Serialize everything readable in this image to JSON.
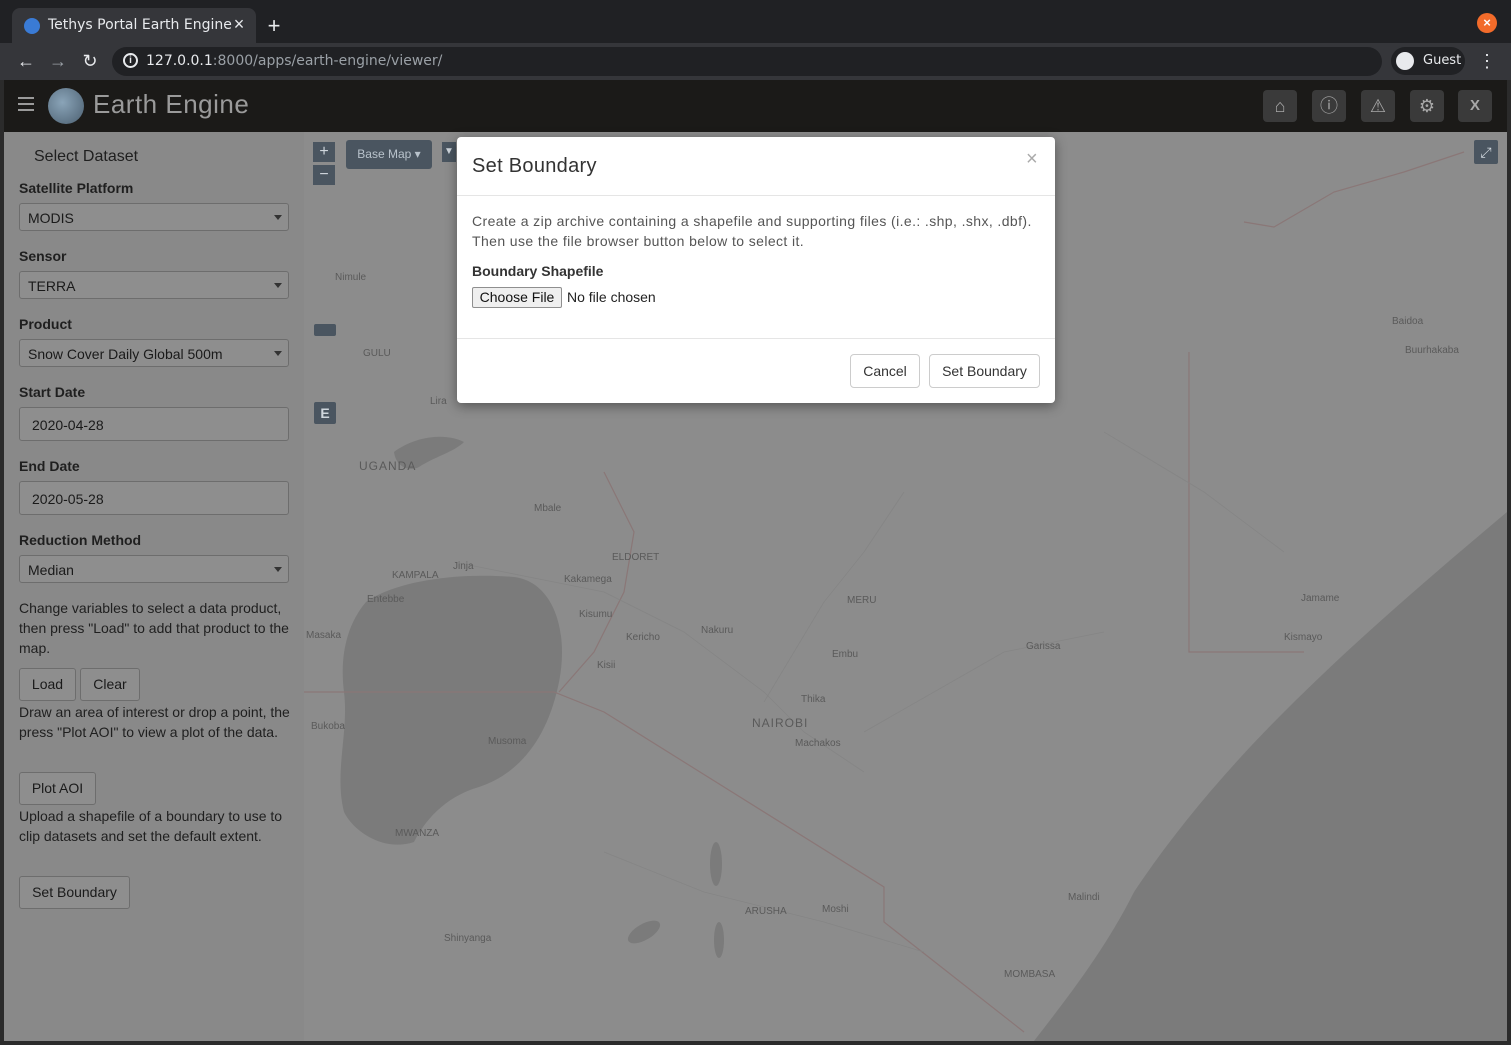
{
  "browser": {
    "tab_title": "Tethys Portal Earth Engine",
    "url_host": "127.0.0.1",
    "url_rest": ":8000/apps/earth-engine/viewer/",
    "profile_label": "Guest",
    "icons": [
      "back-arrow-icon",
      "forward-arrow-icon",
      "reload-icon",
      "info-icon",
      "close-icon",
      "plus-icon",
      "kebab-menu-icon"
    ],
    "window_close_color": "#f26b2a"
  },
  "app": {
    "title": "Earth Engine",
    "header_icons": [
      "home-icon",
      "info-icon",
      "warning-icon",
      "gear-icon"
    ],
    "exit_label": "X"
  },
  "sidebar": {
    "title": "Select Dataset",
    "platform_label": "Satellite Platform",
    "platform_value": "MODIS",
    "sensor_label": "Sensor",
    "sensor_value": "TERRA",
    "product_label": "Product",
    "product_value": "Snow Cover Daily Global 500m",
    "start_label": "Start Date",
    "start_value": "2020-04-28",
    "end_label": "End Date",
    "end_value": "2020-05-28",
    "reduction_label": "Reduction Method",
    "reduction_value": "Median",
    "load_help": "Change variables to select a data product, then press \"Load\" to add that product to the map.",
    "load_label": "Load",
    "clear_label": "Clear",
    "plot_help": "Draw an area of interest or drop a point, the press \"Plot AOI\" to view a plot of the data.",
    "plot_label": "Plot AOI",
    "boundary_help": "Upload a shapefile of a boundary to use to clip datasets and set the default extent.",
    "boundary_label": "Set Boundary"
  },
  "map": {
    "basemap_label": "Base Map",
    "zoom_in": "+",
    "zoom_out": "−",
    "draw_label": "E",
    "fullscreen_icon": "expand-icon",
    "places": {
      "nimule": "Nimule",
      "gulu": "GULU",
      "lira": "Lira",
      "uganda": "UGANDA",
      "mbale": "Mbale",
      "eldoret": "ELDORET",
      "kampala": "KAMPALA",
      "jinja": "Jinja",
      "kakamega": "Kakamega",
      "entebbe": "Entebbe",
      "kisumu": "Kisumu",
      "masaka": "Masaka",
      "kericho": "Kericho",
      "nakuru": "Nakuru",
      "kisii": "Kisii",
      "meru": "MERU",
      "embu": "Embu",
      "thika": "Thika",
      "nairobi": "NAIROBI",
      "machakos": "Machakos",
      "bukoba": "Bukoba",
      "musoma": "Musoma",
      "mwanza": "MWANZA",
      "arusha": "ARUSHA",
      "moshi": "Moshi",
      "shinyanga": "Shinyanga",
      "mombasa": "MOMBASA",
      "malindi": "Malindi",
      "garissa": "Garissa",
      "jamame": "Jamame",
      "kismayo": "Kismayo",
      "baidoa": "Baidoa",
      "buurhakaba": "Buurhakaba"
    }
  },
  "modal": {
    "title": "Set Boundary",
    "close": "×",
    "description": "Create a zip archive containing a shapefile and supporting files (i.e.: .shp, .shx, .dbf). Then use the file browser button below to select it.",
    "field_label": "Boundary Shapefile",
    "file_button": "Choose File",
    "file_status": "No file chosen",
    "cancel_label": "Cancel",
    "submit_label": "Set Boundary"
  }
}
